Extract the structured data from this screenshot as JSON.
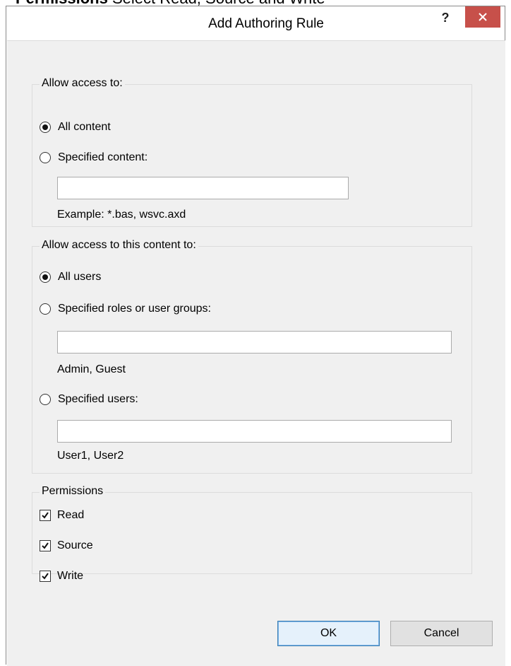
{
  "caption": {
    "bold": "Permissions",
    "rest": " Select Read, Source and Write"
  },
  "dialog": {
    "title": "Add Authoring Rule",
    "help_label": "?",
    "close_icon": "close-icon"
  },
  "content_group": {
    "label": "Allow access to:",
    "all_content_label": "All content",
    "all_content_selected": true,
    "specified_content_label": "Specified content:",
    "specified_content_value": "",
    "example_text": "Example: *.bas, wsvc.axd"
  },
  "users_group": {
    "label": "Allow access to this content to:",
    "all_users_label": "All users",
    "all_users_selected": true,
    "roles_label": "Specified roles or user groups:",
    "roles_value": "",
    "roles_hint": "Admin, Guest",
    "users_label": "Specified users:",
    "users_value": "",
    "users_hint": "User1, User2"
  },
  "permissions_group": {
    "label": "Permissions",
    "items": [
      {
        "label": "Read",
        "checked": true
      },
      {
        "label": "Source",
        "checked": true
      },
      {
        "label": "Write",
        "checked": true
      }
    ]
  },
  "buttons": {
    "ok_label": "OK",
    "cancel_label": "Cancel"
  },
  "colors": {
    "close_button": "#c7504a",
    "client_background": "#f0f0f0",
    "default_button_border": "#3c7fb1"
  }
}
